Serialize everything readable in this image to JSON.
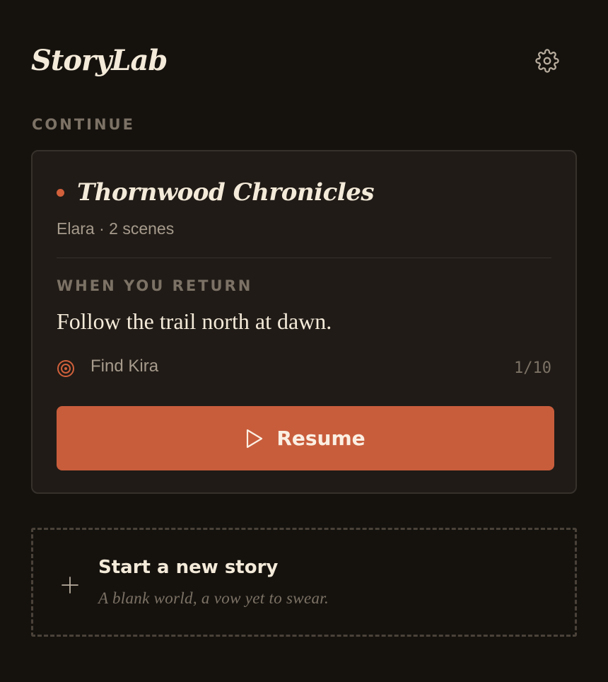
{
  "app": {
    "title": "StoryLab",
    "settings_icon": "gear-icon"
  },
  "continue_section": {
    "label": "CONTINUE"
  },
  "story": {
    "title": "Thornwood Chronicles",
    "meta": "Elara · 2 scenes",
    "status_color": "#d1603b",
    "return_label": "WHEN YOU RETURN",
    "return_text": "Follow the trail north at dawn.",
    "goal": {
      "icon": "target-icon",
      "label": "Find Kira",
      "progress": "1/10"
    },
    "resume": {
      "icon": "play-icon",
      "label": "Resume"
    }
  },
  "new_story": {
    "icon": "plus-icon",
    "title": "Start a new story",
    "subtitle": "A blank world, a vow yet to swear."
  },
  "colors": {
    "background": "#15120e",
    "card": "#201b17",
    "accent": "#c85d3c"
  }
}
